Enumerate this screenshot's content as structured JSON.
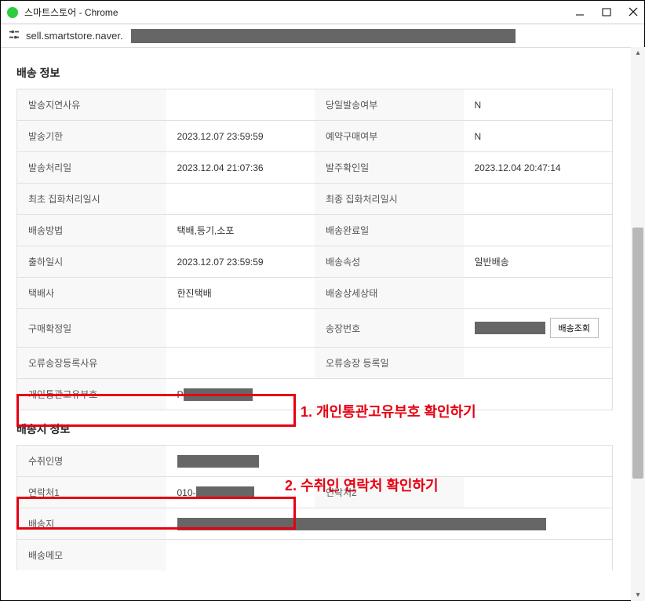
{
  "window": {
    "title": "스마트스토어 - Chrome"
  },
  "address": {
    "url": "sell.smartstore.naver."
  },
  "sections": {
    "delivery": {
      "title": "배송 정보"
    },
    "destination": {
      "title": "배송지 정보"
    }
  },
  "delivery_rows": [
    {
      "l1": "발송지연사유",
      "v1": "",
      "l2": "당일발송여부",
      "v2": "N"
    },
    {
      "l1": "발송기한",
      "v1": "2023.12.07 23:59:59",
      "l2": "예약구매여부",
      "v2": "N"
    },
    {
      "l1": "발송처리일",
      "v1": "2023.12.04 21:07:36",
      "l2": "발주확인일",
      "v2": "2023.12.04 20:47:14"
    },
    {
      "l1": "최초 집화처리일시",
      "v1": "",
      "l2": "최종 집화처리일시",
      "v2": ""
    },
    {
      "l1": "배송방법",
      "v1": "택배,등기,소포",
      "l2": "배송완료일",
      "v2": ""
    },
    {
      "l1": "출하일시",
      "v1": "2023.12.07 23:59:59",
      "l2": "배송속성",
      "v2": "일반배송"
    },
    {
      "l1": "택배사",
      "v1": "한진택배",
      "l2": "배송상세상태",
      "v2": ""
    }
  ],
  "delivery_confirm": {
    "l1": "구매확정일",
    "v1": "",
    "l2": "송장번호",
    "track_btn": "배송조회"
  },
  "delivery_error": {
    "l1": "오류송장등록사유",
    "v1": "",
    "l2": "오류송장 등록일",
    "v2": ""
  },
  "delivery_pccc": {
    "l1": "개인통관고유부호",
    "v1prefix": "P"
  },
  "dest": {
    "name": {
      "l": "수취인명"
    },
    "phone": {
      "l1": "연락처1",
      "v1prefix": "010-",
      "l2": "연락처2",
      "v2": ""
    },
    "addr": {
      "l": "배송지"
    },
    "memo": {
      "l": "배송메모"
    }
  },
  "annotations": {
    "a1": "1. 개인통관고유부호 확인하기",
    "a2": "2. 수취인 연락처 확인하기"
  }
}
